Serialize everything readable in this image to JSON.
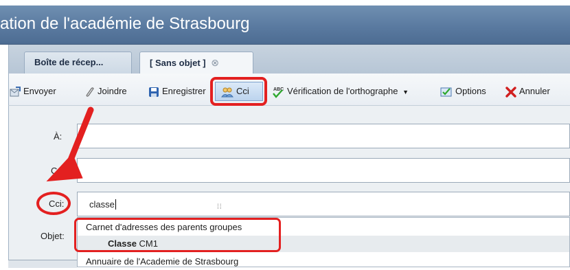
{
  "window": {
    "title": "ation de l'académie de Strasbourg"
  },
  "tabs": [
    {
      "label": "Boîte de récep..."
    },
    {
      "label": "[ Sans objet ]",
      "close_glyph": "⊗"
    }
  ],
  "toolbar": {
    "send_label": "Envoyer",
    "attach_label": "Joindre",
    "save_label": "Enregistrer",
    "bcc_label": "Cci",
    "spellcheck_label": "Vérification de l'orthographe",
    "options_label": "Options",
    "cancel_label": "Annuler"
  },
  "form": {
    "to_label": "À:",
    "cc_label": "Cc",
    "bcc_label": "Cci:",
    "bcc_value": "classe",
    "subject_label": "Objet:"
  },
  "autocomplete": {
    "group_header": "Carnet d'adresses des parents groupes",
    "item_bold": "Classe",
    "item_rest": "CM1",
    "next_group": "Annuaire de l'Academie de Strasbourg"
  },
  "colors": {
    "highlight_red": "#e32020",
    "titlebar_blue": "#5a7aa0"
  },
  "icons": [
    "send-icon",
    "paperclip-icon",
    "floppy-icon",
    "contacts-icon",
    "spellcheck-icon",
    "options-icon",
    "cancel-x-icon",
    "dropdown-arrow-icon"
  ]
}
